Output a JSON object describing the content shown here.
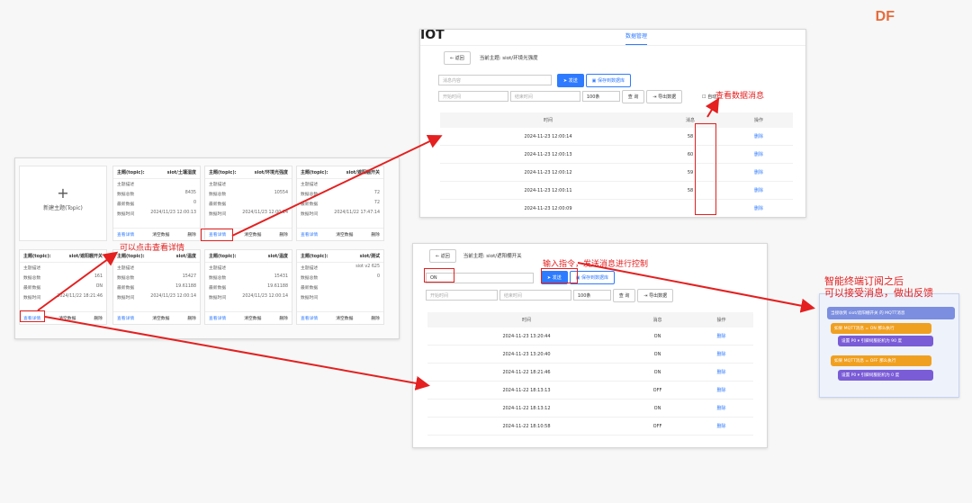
{
  "brand": "DF",
  "topics_panel": {
    "new_topic": "新建主题(Topic)",
    "cards": [
      {
        "label": "主题(topic):",
        "name": "siot/土壤湿度",
        "rows": [
          [
            "主题描述",
            ""
          ],
          [
            "数据总数",
            "8435"
          ],
          [
            "最新数据",
            "0"
          ],
          [
            "数据时间",
            "2024/11/23 12:00:13"
          ]
        ]
      },
      {
        "label": "主题(topic):",
        "name": "siot/环境光强度",
        "rows": [
          [
            "主题描述",
            ""
          ],
          [
            "数据总数",
            "10554"
          ],
          [
            "最新数据",
            ""
          ],
          [
            "数据时间",
            "2024/11/23 12:00:14"
          ]
        ]
      },
      {
        "label": "主题(topic):",
        "name": "siot/遮阳棚开关",
        "rows": [
          [
            "主题描述",
            ""
          ],
          [
            "数据总数",
            "72"
          ],
          [
            "最新数据",
            "72"
          ],
          [
            "数据时间",
            "2024/11/22 17:47:14"
          ]
        ]
      },
      {
        "label": "主题(topic):",
        "name": "siot/遮阳棚开关",
        "rows": [
          [
            "主题描述",
            ""
          ],
          [
            "数据总数",
            "161"
          ],
          [
            "最新数据",
            "ON"
          ],
          [
            "数据时间",
            "2024/11/22 18:21:46"
          ]
        ]
      },
      {
        "label": "主题(topic):",
        "name": "siot/温度",
        "rows": [
          [
            "主题描述",
            ""
          ],
          [
            "数据总数",
            "15427"
          ],
          [
            "最新数据",
            "19.61188"
          ],
          [
            "数据时间",
            "2024/11/23 12:00:14"
          ]
        ]
      },
      {
        "label": "主题(topic):",
        "name": "siot/温度",
        "rows": [
          [
            "主题描述",
            ""
          ],
          [
            "数据总数",
            "15431"
          ],
          [
            "最新数据",
            "19.61188"
          ],
          [
            "数据时间",
            "2024/11/23 12:00:14"
          ]
        ]
      },
      {
        "label": "主题(topic):",
        "name": "siot/测试",
        "rows": [
          [
            "主题描述",
            "siot v2 625"
          ],
          [
            "数据总数",
            "0"
          ],
          [
            "最新数据",
            ""
          ],
          [
            "数据时间",
            ""
          ]
        ]
      }
    ],
    "actions": [
      "查看详情",
      "清空数据",
      "删除"
    ]
  },
  "panel_top": {
    "logo": "IOT",
    "tab": "数据管理",
    "back": "← 返回",
    "current_topic": "当前主题: siot/环境光强度",
    "msg_placeholder": "消息内容",
    "send": "发送",
    "save_db": "保存到数据库",
    "start_time": "开始时间",
    "end_time": "结束时间",
    "count": "100条",
    "query": "查 询",
    "export": "导出数据",
    "auto": "自动",
    "col_time": "时间",
    "col_msg": "消息",
    "col_op": "操作",
    "rows": [
      [
        "2024-11-23 12:00:14",
        "58",
        "删除"
      ],
      [
        "2024-11-23 12:00:13",
        "60",
        "删除"
      ],
      [
        "2024-11-23 12:00:12",
        "59",
        "删除"
      ],
      [
        "2024-11-23 12:00:11",
        "58",
        "删除"
      ],
      [
        "2024-11-23 12:00:09",
        "",
        "删除"
      ]
    ]
  },
  "panel_bottom": {
    "back": "← 返回",
    "current_topic": "当前主题: siot/遮阳棚开关",
    "msg_value": "ON",
    "send": "发送",
    "save_db": "保存到数据库",
    "start_time": "开始时间",
    "end_time": "结束时间",
    "count": "100条",
    "query": "查 询",
    "export": "导出数据",
    "col_time": "时间",
    "col_msg": "消息",
    "col_op": "操作",
    "rows": [
      [
        "2024-11-23 13:20:44",
        "ON",
        "删除"
      ],
      [
        "2024-11-23 13:20:40",
        "ON",
        "删除"
      ],
      [
        "2024-11-22 18:21:46",
        "ON",
        "删除"
      ],
      [
        "2024-11-22 18:13:13",
        "OFF",
        "删除"
      ],
      [
        "2024-11-22 18:13:12",
        "ON",
        "删除"
      ],
      [
        "2024-11-22 18:10:58",
        "OFF",
        "删除"
      ]
    ]
  },
  "annotations": {
    "view_msg": "查看数据消息",
    "can_click": "可以点击查看详情",
    "input_cmd": "输入指令，发送消息进行控制",
    "terminal_line1": "智能终端订阅之后",
    "terminal_line2": "可以接受消息，做出反馈"
  },
  "code_blocks": {
    "subscribe": "当接收到 siot/遮阳棚开关 的 MQTT消息",
    "if_on": "如果 MQTT消息 = ON 那么执行",
    "set_on": "设置 P0 ▾ 引脚伺服舵机为 90 度",
    "if_off": "如果 MQTT消息 = OFF 那么执行",
    "set_off": "设置 P0 ▾ 引脚伺服舵机为 0 度"
  }
}
